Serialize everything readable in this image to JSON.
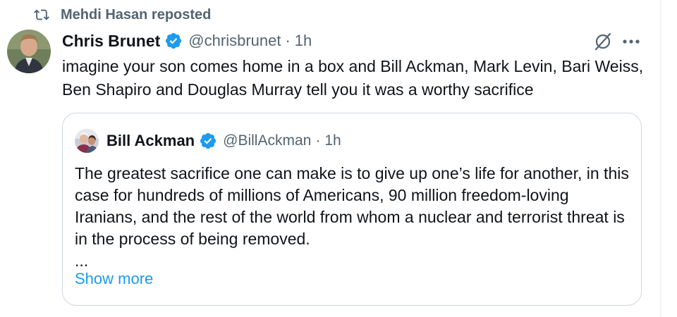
{
  "repost": {
    "icon": "repost-icon",
    "text": "Mehdi Hasan reposted"
  },
  "post": {
    "avatar": "avatar",
    "author_name": "Chris Brunet",
    "verified_icon": "verified-badge-icon",
    "handle": "@chrisbrunet",
    "separator": "·",
    "time": "1h",
    "grok_icon": "grok-icon",
    "more_icon": "more-options-icon",
    "text": "imagine your son comes home in a box and Bill Ackman, Mark Levin, Bari Weiss, Ben Shapiro and Douglas Murray tell you it was a worthy sacrifice"
  },
  "quote": {
    "avatar": "avatar",
    "author_name": "Bill Ackman",
    "verified_icon": "verified-badge-icon",
    "handle": "@BillAckman",
    "separator": "·",
    "time": "1h",
    "text": "The greatest sacrifice one can make is to give up one’s life for another, in this case for hundreds of millions of Americans, 90 million freedom-loving Iranians, and the rest of the world from whom a nuclear and terrorist threat is in the process of being removed.",
    "ellipsis": "...",
    "show_more": "Show more"
  },
  "colors": {
    "text_primary": "#0f1419",
    "text_secondary": "#536471",
    "link": "#1d9bf0",
    "verified": "#1d9bf0",
    "border": "#cfd9de"
  }
}
